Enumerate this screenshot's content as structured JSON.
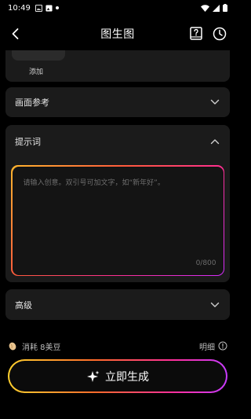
{
  "status_bar": {
    "time": "10:49"
  },
  "nav": {
    "title": "图生图"
  },
  "image_section": {
    "add_label": "添加"
  },
  "reference_section": {
    "label": "画面参考"
  },
  "prompt_section": {
    "label": "提示词",
    "placeholder": "请输入创意。双引号可加文字，如“新年好”。",
    "counter": "0/800"
  },
  "advanced_section": {
    "label": "高级"
  },
  "cost": {
    "text": "消耗 8美豆",
    "detail_label": "明细"
  },
  "generate_button": {
    "label": "立即生成"
  },
  "colors": {
    "background": "#000000",
    "card": "#1b1b1b",
    "gradient": [
      "#ffd12e",
      "#ff6a2a",
      "#ff2f9a",
      "#c73bff"
    ]
  }
}
